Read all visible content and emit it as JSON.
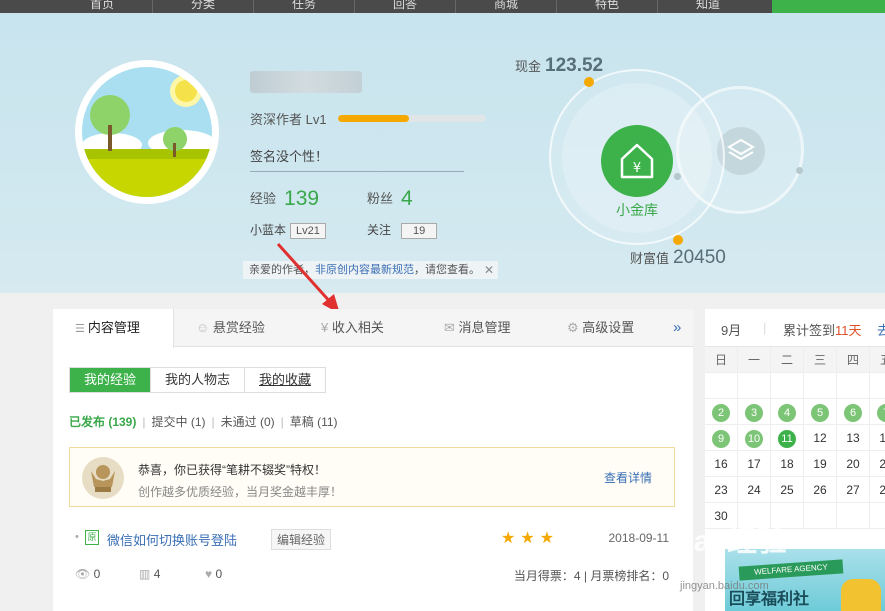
{
  "nav": {
    "items": [
      "首页",
      "分类",
      "任务",
      "回答",
      "商城",
      "特色",
      "知道"
    ]
  },
  "profile": {
    "level_label": "资深作者 Lv1",
    "level_progress": 0.48,
    "signature": "签名没个性！",
    "exp_label": "经验",
    "exp_value": "139",
    "fans_label": "粉丝",
    "fans_value": "4",
    "blue_label": "小蓝本",
    "blue_tag": "Lv21",
    "follow_label": "关注",
    "follow_tag": "19",
    "notice_prefix": "亲爱的作者，",
    "notice_link": "非原创内容最新规范",
    "notice_suffix": "，请您查看。",
    "close_icon": "close-icon"
  },
  "finance": {
    "cash_label": "现金",
    "cash_value": "123.52",
    "bank_label": "小金库",
    "wealth_label": "财富值",
    "wealth_value": "20450"
  },
  "tabs": [
    {
      "label": "内容管理",
      "icon": "list-icon"
    },
    {
      "label": "悬赏经验",
      "icon": "reward-icon"
    },
    {
      "label": "收入相关",
      "icon": "yen-icon"
    },
    {
      "label": "消息管理",
      "icon": "mail-icon"
    },
    {
      "label": "高级设置",
      "icon": "gear-icon"
    }
  ],
  "tabs_more": "»",
  "subtabs": [
    "我的经验",
    "我的人物志",
    "我的收藏"
  ],
  "filters": {
    "published": "已发布 (139)",
    "submitting": "提交中 (1)",
    "rejected": "未通过 (0)",
    "draft": "草稿 (11)"
  },
  "award": {
    "line1": "恭喜，你已获得“笔耕不辍奖”特权！",
    "line2": "创作越多优质经验，当月奖金越丰厚！",
    "link": "查看详情"
  },
  "experience": {
    "tag": "原",
    "title": "微信如何切换账号登陆",
    "edit": "编辑经验",
    "stars": "★★★",
    "date": "2018-09-11",
    "views": "0",
    "votes": "4",
    "likes": "0",
    "monthly": "当月得票：4 | 月票榜排名：0"
  },
  "calendar": {
    "month": "9月",
    "signin_label": "累计签到",
    "signin_value": "11天",
    "signin_more": "去",
    "weekdays": [
      "日",
      "一",
      "二",
      "三",
      "四",
      "五"
    ],
    "green_color": "#7cc576",
    "today_color": "#3db24b"
  },
  "banner": {
    "text": "回享福利社",
    "ribbon": "WELFARE AGENCY"
  },
  "watermark": {
    "text": "Bai 经验",
    "url": "jingyan.baidu.com"
  }
}
